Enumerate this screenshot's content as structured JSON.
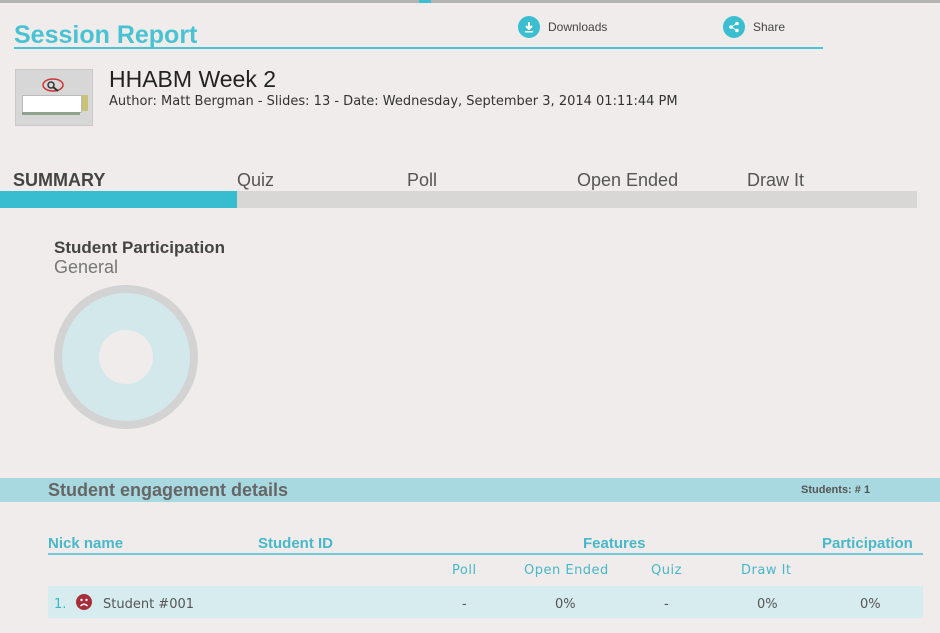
{
  "header": {
    "title": "Session Report",
    "downloads_label": "Downloads",
    "share_label": "Share"
  },
  "session": {
    "title": "HHABM Week 2",
    "meta": "Author: Matt Bergman - Slides: 13 - Date: Wednesday, September 3, 2014 01:11:44 PM"
  },
  "tabs": [
    {
      "label": "SUMMARY",
      "active": true
    },
    {
      "label": "Quiz"
    },
    {
      "label": "Poll"
    },
    {
      "label": "Open Ended"
    },
    {
      "label": "Draw It"
    }
  ],
  "participation": {
    "title": "Student Participation",
    "subtitle": "General"
  },
  "engagement": {
    "title": "Student engagement details",
    "students_count": "Students: # 1",
    "headers": {
      "nick": "Nick name",
      "id": "Student ID",
      "features": "Features",
      "participation": "Participation"
    },
    "features": [
      "Poll",
      "Open Ended",
      "Quiz",
      "Draw It"
    ],
    "rows": [
      {
        "num": "1.",
        "name": "Student #001",
        "poll": "-",
        "open_ended": "0%",
        "quiz": "-",
        "draw_it": "0%",
        "participation": "0%"
      }
    ]
  },
  "icons": {
    "downloads": "download-icon",
    "share": "share-icon",
    "status": "sad-face-icon"
  },
  "colors": {
    "accent": "#48c3d3",
    "status_sad": "#a72d3a"
  }
}
